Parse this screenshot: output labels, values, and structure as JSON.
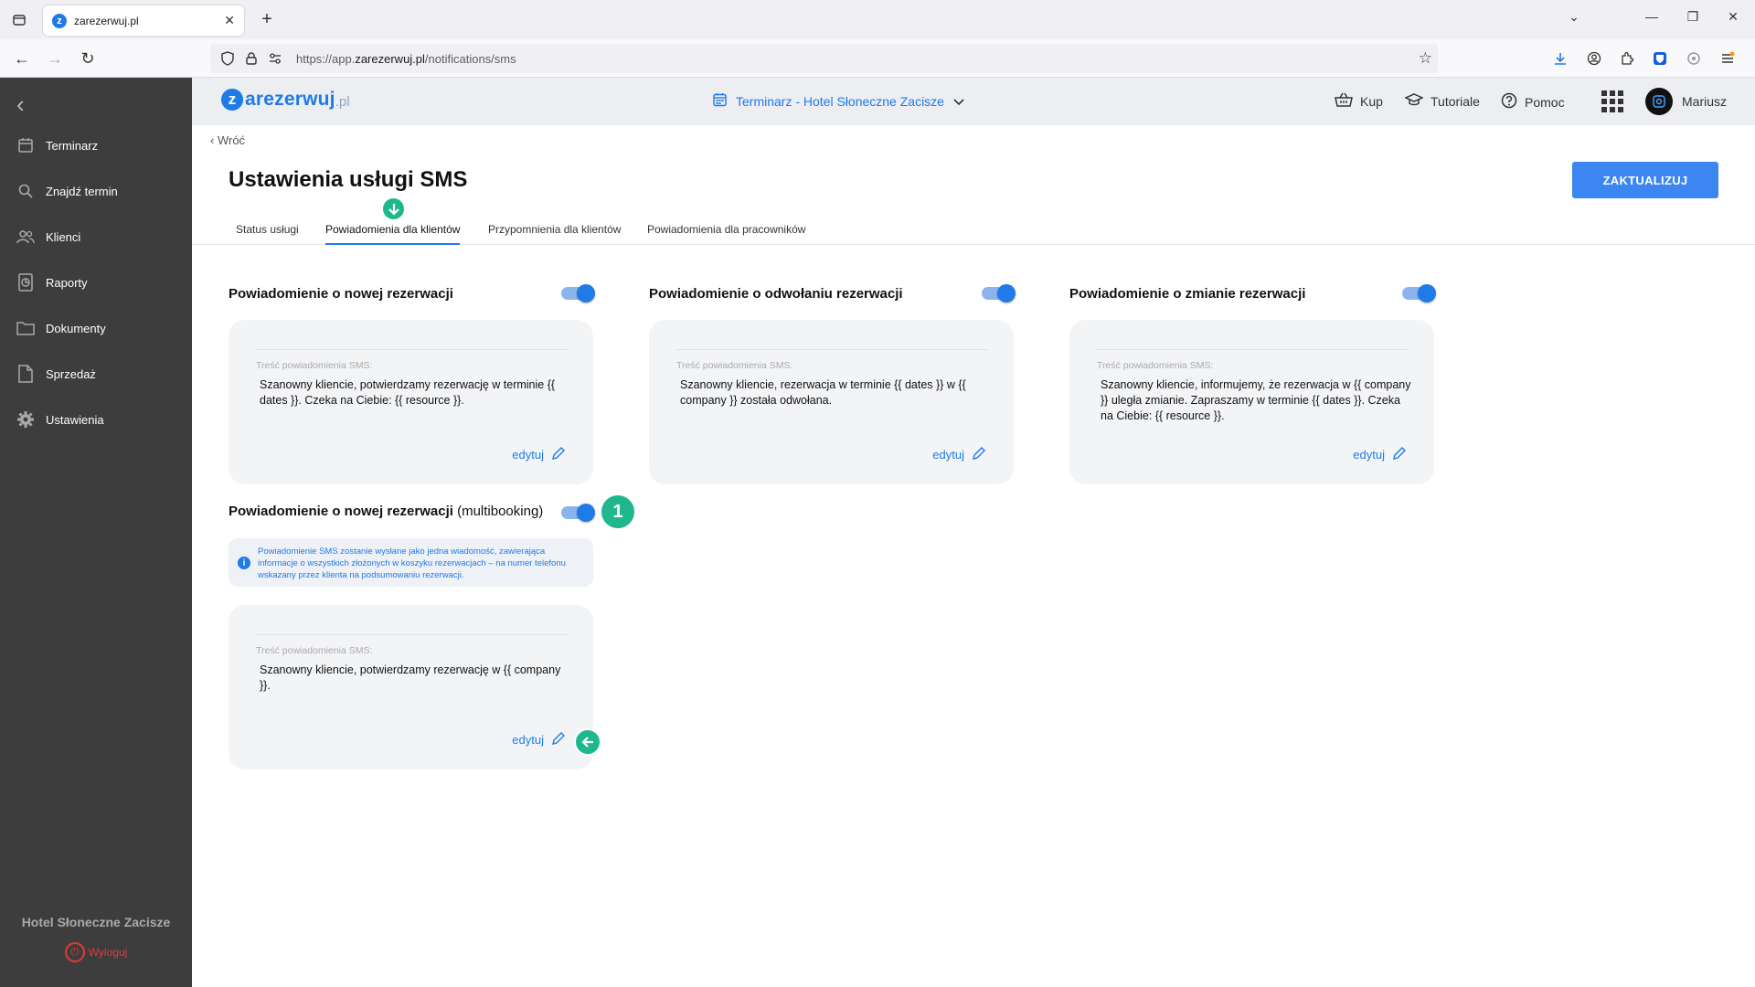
{
  "browser": {
    "tab_title": "zarezerwuj.pl",
    "tab_favicon_letter": "z",
    "url_prefix": "https://app.",
    "url_domain": "zarezerwuj.pl",
    "url_path": "/notifications/sms"
  },
  "sidebar": {
    "items": [
      {
        "label": "Terminarz",
        "icon": "calendar-icon"
      },
      {
        "label": "Znajdź termin",
        "icon": "search-icon"
      },
      {
        "label": "Klienci",
        "icon": "users-icon"
      },
      {
        "label": "Raporty",
        "icon": "report-icon"
      },
      {
        "label": "Dokumenty",
        "icon": "folder-icon"
      },
      {
        "label": "Sprzedaż",
        "icon": "document-icon"
      },
      {
        "label": "Ustawienia",
        "icon": "gear-icon"
      }
    ],
    "hotel_name": "Hotel Słoneczne Zacisze",
    "logout_label": "Wyloguj"
  },
  "header": {
    "logo_z": "z",
    "logo_text": "arezerwuj",
    "logo_suffix": ".pl",
    "calendar_selector": "Terminarz - Hotel Słoneczne Zacisze",
    "buy_label": "Kup",
    "tutorials_label": "Tutoriale",
    "help_label": "Pomoc",
    "user_name": "Mariusz"
  },
  "page": {
    "back_label": "Wróć",
    "title": "Ustawienia usługi SMS",
    "update_button": "ZAKTUALIZUJ",
    "tabs": [
      {
        "label": "Status usługi",
        "active": false
      },
      {
        "label": "Powiadomienia dla klientów",
        "active": true
      },
      {
        "label": "Przypomnienia dla klientów",
        "active": false
      },
      {
        "label": "Powiadomienia dla pracowników",
        "active": false
      }
    ]
  },
  "notifications": {
    "new": {
      "title": "Powiadomienie o nowej rezerwacji",
      "enabled": true,
      "content_label": "Treść powiadomienia SMS:",
      "message": "Szanowny kliencie, potwierdzamy rezerwację w terminie {{ dates }}. Czeka na Ciebie: {{ resource }}.",
      "edit_label": "edytuj"
    },
    "cancel": {
      "title": "Powiadomienie o odwołaniu rezerwacji",
      "enabled": true,
      "content_label": "Treść powiadomienia SMS:",
      "message": "Szanowny kliencie, rezerwacja w terminie {{ dates }} w {{ company }} została odwołana.",
      "edit_label": "edytuj"
    },
    "change": {
      "title": "Powiadomienie o zmianie rezerwacji",
      "enabled": true,
      "content_label": "Treść powiadomienia SMS:",
      "message": "Szanowny kliencie, informujemy, że rezerwacja w {{ company }} uległa zmianie. Zapraszamy w terminie {{ dates }}. Czeka na Ciebie: {{ resource }}.",
      "edit_label": "edytuj"
    },
    "multibooking": {
      "title": "Powiadomienie o nowej rezerwacji",
      "title_suffix": "(multibooking)",
      "enabled": true,
      "info": "Powiadomienie SMS zostanie wysłane jako jedna wiadomość, zawierająca informacje o wszystkich złożonych w koszyku rezerwacjach – na numer telefonu wskazany przez klienta na podsumowaniu rezerwacji.",
      "content_label": "Treść powiadomienia SMS:",
      "message": "Szanowny kliencie, potwierdzamy rezerwację w {{ company }}.",
      "edit_label": "edytuj"
    }
  },
  "annotations": {
    "step_number": "1",
    "accent_color": "#1fb88e"
  },
  "colors": {
    "brand": "#1e7be8",
    "sidebar_bg": "#3d3d3d",
    "button": "#3b86f0"
  }
}
